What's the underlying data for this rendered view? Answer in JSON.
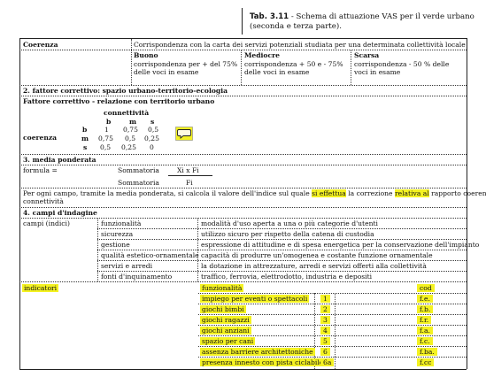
{
  "caption": {
    "number": "Tab. 3.11",
    "line1": " - Schema di attuazione VAS per il verde urbano",
    "line2": "(seconda e terza parte)."
  },
  "coerenza": {
    "label": "Coerenza",
    "desc": "Corrispondenza con la carta dei servizi potenziali studiata per una determinata collettività locale",
    "levels": [
      {
        "head": "Buono",
        "l1": "corrispondenza per + del 75%",
        "l2": "delle voci in esame"
      },
      {
        "head": "Mediocre",
        "l1": "corrispondenza + 50 e - 75%",
        "l2": "delle voci in esame"
      },
      {
        "head": "Scarsa",
        "l1": "corrispondenza - 50 % delle",
        "l2": "voci in esame"
      }
    ]
  },
  "section2": {
    "title": "2. fattore correttivo: spazio urbano-territorio-ecologia",
    "subtitle": "Fattore correttivo - relazione con territorio urbano",
    "matrix": {
      "col_title": "connettività",
      "row_title": "coerenza",
      "col_heads": [
        "b",
        "m",
        "s"
      ],
      "rows": [
        {
          "k": "b",
          "v": [
            "1",
            "0,75",
            "0,5"
          ]
        },
        {
          "k": "m",
          "v": [
            "0,75",
            "0,5",
            "0,25"
          ]
        },
        {
          "k": "s",
          "v": [
            "0,5",
            "0,25",
            "0"
          ]
        }
      ]
    }
  },
  "section3": {
    "title": "3. media ponderata",
    "formula_label": "formula =",
    "sum1": "Sommatoria",
    "numerator": "Xi x Fi",
    "sum2": "Sommatoria",
    "denominator": "Fi",
    "note_a": "Per ogni campo, tramite la media ponderata, si calcola il valore dell'indice sul quale ",
    "note_h1": "si effettua",
    "note_b": " la correzione ",
    "note_h2": "relativa al",
    "note_c": " rapporto coerenza-",
    "note_d": "connettività"
  },
  "section4": {
    "title": "4. campi d'indagine",
    "col_label": "campi (indici)",
    "fields": [
      {
        "name": "funzionalità",
        "desc": "modalità d'uso aperta a una o più categorie d'utenti"
      },
      {
        "name": "sicurezza",
        "desc": "utilizzo sicuro per rispetto della catena di custodia"
      },
      {
        "name": "gestione",
        "desc": "espressione di attitudine e di spesa energetica per la conservazione dell'impianto"
      },
      {
        "name": "qualità estetico-ornamentale",
        "desc": "capacità di produrre un'omogenea e costante funzione ornamentale"
      },
      {
        "name": "servizi e arredi",
        "desc": "la dotazione in attrezzature, arredi e servizi offerti alla collettività"
      },
      {
        "name": "fonti d'inquinamento",
        "desc": "traffico, ferrovia, elettrodotto, industria e depositi"
      }
    ],
    "indicators_label": "indicatori",
    "ind_head": {
      "name": "funzionalità",
      "code": "cod"
    },
    "indicators": [
      {
        "name": "impiego per eventi o spettacoli",
        "num": "1",
        "code": "f.e."
      },
      {
        "name": "giochi bimbi",
        "num": "2",
        "code": "f.b."
      },
      {
        "name": "giochi ragazzi",
        "num": "3",
        "code": "f.r."
      },
      {
        "name": "giochi anziani",
        "num": "4",
        "code": "f.a."
      },
      {
        "name": "spazio per cani",
        "num": "5",
        "code": "f.c."
      },
      {
        "name": "assenza barriere architettoniche",
        "num": "6",
        "code": "f.ba."
      },
      {
        "name": "presenza innesto con pista ciclabile",
        "num": "6a",
        "code": "f.cc"
      }
    ]
  },
  "colors": {
    "highlight": "#f4f222",
    "comment_icon": "#f4f222"
  },
  "icons": {
    "comment": "comment-note-icon"
  }
}
